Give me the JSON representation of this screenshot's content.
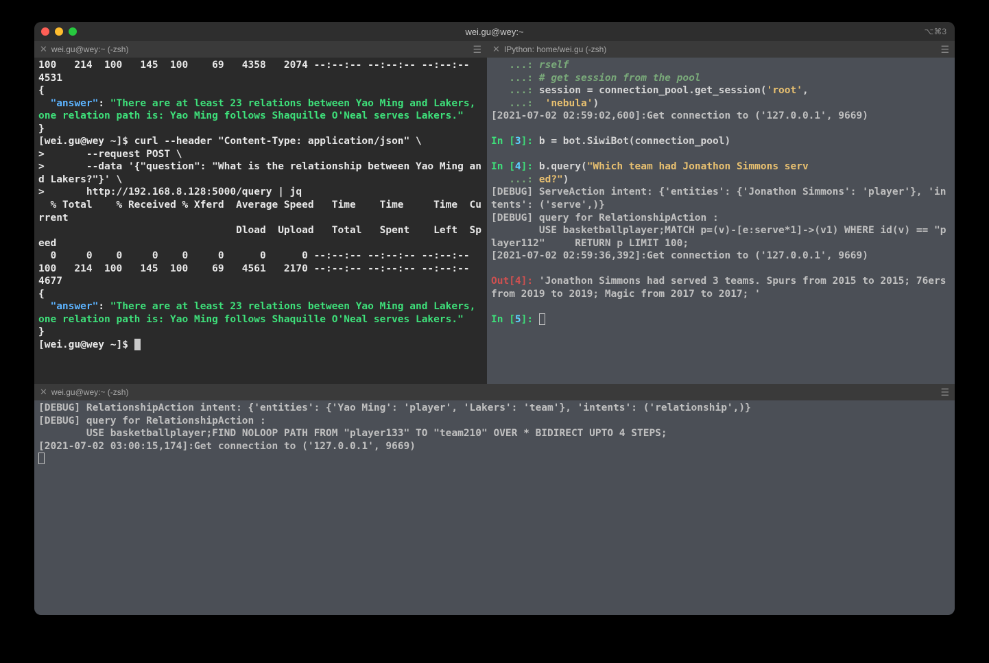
{
  "window": {
    "title": "wei.gu@wey:~",
    "meta": "⌥⌘3"
  },
  "tabs": {
    "left": "wei.gu@wey:~ (-zsh)",
    "right": "IPython: home/wei.gu (-zsh)",
    "bottom": "wei.gu@wey:~ (-zsh)"
  },
  "left": {
    "line1": "100   214  100   145  100    69   4358   2074 --:--:-- --:--:-- --:--:--  4531",
    "brace_open": "{",
    "key1": "\"answer\"",
    "colon1": ": ",
    "val1": "\"There are at least 23 relations between Yao Ming and Lakers, one relation path is: Yao Ming follows Shaquille O'Neal serves Lakers.\"",
    "brace_close": "}",
    "prompt1": "[wei.gu@wey ~]$ ",
    "curl1": "curl --header \"Content-Type: application/json\" \\",
    "curl2": ">       --request POST \\",
    "curl3": ">       --data '{\"question\": \"What is the relationship between Yao Ming and Lakers?\"}' \\",
    "curl4": ">       http://192.168.8.128:5000/query | jq",
    "hdr1": "  % Total    % Received % Xferd  Average Speed   Time    Time     Time  Current",
    "hdr2": "                                 Dload  Upload   Total   Spent    Left  Speed",
    "zeros": "  0     0    0     0    0     0      0      0 --:--:-- --:--:-- --:--:--",
    "line2": "100   214  100   145  100    69   4561   2170 --:--:-- --:--:-- --:--:--  4677",
    "prompt2": "[wei.gu@wey ~]$ "
  },
  "right": {
    "dots": "   ...: ",
    "rself": "rself",
    "comment": "# get session from the pool",
    "sess1": "session = connection_pool.get_session(",
    "root": "'root'",
    "comma": ",",
    "nebula": " 'nebula'",
    "paren": ")",
    "log1": "[2021-07-02 02:59:02,600]:Get connection to ('127.0.0.1', 9669)",
    "in3_a": "In [",
    "in3_n": "3",
    "in3_b": "]: ",
    "in3_code": "b = bot.SiwiBot(connection_pool)",
    "in4_n": "4",
    "in4_code": "b.query(",
    "in4_q1": "\"Which team had Jonathon Simmons serv",
    "in4_q2": "ed?\"",
    "in4_end": ")",
    "dbg1": "[DEBUG] ServeAction intent: {'entities': {'Jonathon Simmons': 'player'}, 'intents': ('serve',)}",
    "dbg2": "[DEBUG] query for RelationshipAction :",
    "dbg3": "        USE basketballplayer;MATCH p=(v)-[e:serve*1]->(v1) WHERE id(v) == \"player112\"     RETURN p LIMIT 100;",
    "log2": "[2021-07-02 02:59:36,392]:Get connection to ('127.0.0.1', 9669)",
    "out4_a": "Out[",
    "out4_n": "4",
    "out4_b": "]: ",
    "out4_txt": "'Jonathon Simmons had served 3 teams. Spurs from 2015 to 2015; 76ers from 2019 to 2019; Magic from 2017 to 2017; '",
    "in5_n": "5"
  },
  "bottom": {
    "l1": "[DEBUG] RelationshipAction intent: {'entities': {'Yao Ming': 'player', 'Lakers': 'team'}, 'intents': ('relationship',)}",
    "l2": "[DEBUG] query for RelationshipAction :",
    "l3": "        USE basketballplayer;FIND NOLOOP PATH FROM \"player133\" TO \"team210\" OVER * BIDIRECT UPTO 4 STEPS;",
    "l4": "[2021-07-02 03:00:15,174]:Get connection to ('127.0.0.1', 9669)"
  }
}
